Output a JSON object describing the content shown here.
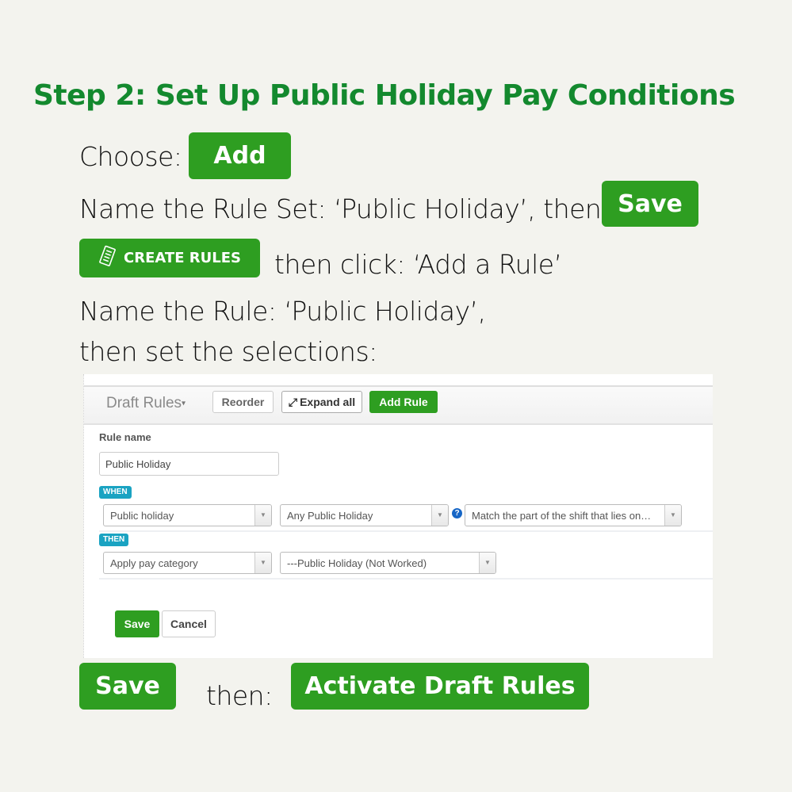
{
  "title": "Step 2: Set Up Public Holiday Pay Conditions",
  "steps": {
    "choose_text": "Choose:",
    "add_button": "Add",
    "name_ruleset_text": "Name the Rule Set: ‘Public Holiday’, then:",
    "save_button": "Save",
    "create_rules_button": "CREATE RULES",
    "create_rules_icon": "document-icon",
    "add_rule_text": "then click: ‘Add a Rule’",
    "name_rule_text": "Name the Rule: ‘Public Holiday’,",
    "set_selections_text": "then set the selections:",
    "final_save_button": "Save",
    "then_text": "then:",
    "activate_button": "Activate Draft Rules"
  },
  "panel": {
    "toolbar": {
      "draft_rules": "Draft Rules",
      "draft_caret": "▾",
      "reorder": "Reorder",
      "expand_icon": "⤢",
      "expand_all": "Expand all",
      "add_rule": "Add Rule"
    },
    "rule_name_label": "Rule name",
    "rule_name_value": "Public Holiday",
    "when_badge": "WHEN",
    "then_badge": "THEN",
    "when_selects": [
      "Public holiday",
      "Any Public Holiday",
      "Match the part of the shift that lies on…"
    ],
    "then_selects": [
      "Apply pay category",
      "---Public Holiday (Not Worked)"
    ],
    "select_arrow": "▼",
    "help_icon": "?",
    "save": "Save",
    "cancel": "Cancel"
  },
  "colors": {
    "brand_green": "#2e9e21",
    "title_green": "#13892e",
    "badge_teal": "#1aa3c2",
    "background": "#f3f3ee"
  }
}
